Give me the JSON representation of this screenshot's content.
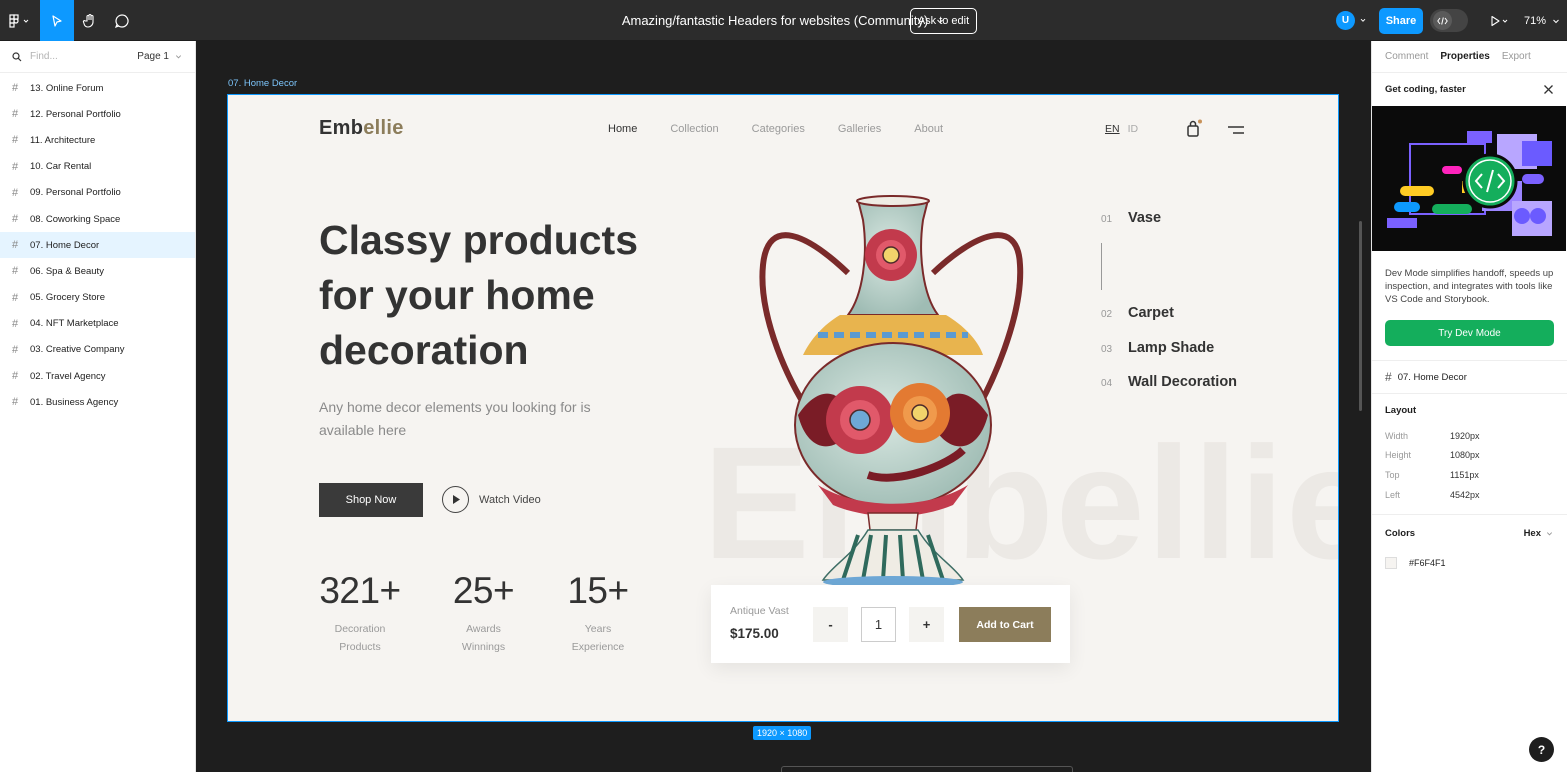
{
  "toolbar": {
    "doc_title": "Amazing/fantastic Headers for websites (Community)",
    "ask_to_edit": "Ask to edit",
    "avatar_initial": "U",
    "share": "Share",
    "zoom": "71%"
  },
  "layers_panel": {
    "search_placeholder": "Find...",
    "page": "Page 1",
    "items": [
      "13. Online Forum",
      "12. Personal Portfolio",
      "11. Architecture",
      "10. Car Rental",
      "09. Personal Portfolio",
      "08. Coworking Space",
      "07. Home Decor",
      "06. Spa & Beauty",
      "05. Grocery Store",
      "04. NFT Marketplace",
      "03. Creative Company",
      "02. Travel Agency",
      "01. Business Agency"
    ],
    "selected_index": 6
  },
  "canvas": {
    "frame_label": "07. Home Decor",
    "size_badge": "1920 × 1080",
    "bg_color": "#f6f4f1",
    "accent_color": "#8c7d5b"
  },
  "site": {
    "logo_main": "Emb",
    "logo_accent": "ellie",
    "nav": [
      "Home",
      "Collection",
      "Categories",
      "Galleries",
      "About"
    ],
    "lang_en": "EN",
    "lang_id": "ID",
    "hero_title": "Classy products for your home decoration",
    "hero_subtitle": "Any home decor elements you looking for is available here",
    "shop_now": "Shop Now",
    "watch_video": "Watch Video",
    "stats": [
      {
        "value": "321+",
        "label": "Decoration Products"
      },
      {
        "value": "25+",
        "label": "Awards Winnings"
      },
      {
        "value": "15+",
        "label": "Years Experience"
      }
    ],
    "watermark": "Embellie",
    "categories": [
      {
        "num": "01",
        "name": "Vase"
      },
      {
        "num": "02",
        "name": "Carpet"
      },
      {
        "num": "03",
        "name": "Lamp Shade"
      },
      {
        "num": "04",
        "name": "Wall Decoration"
      }
    ],
    "product": {
      "name": "Antique Vast",
      "price": "$175.00",
      "minus": "-",
      "qty": "1",
      "plus": "+",
      "add_to_cart": "Add to Cart"
    }
  },
  "properties_panel": {
    "tabs": [
      "Comment",
      "Properties",
      "Export"
    ],
    "active_tab": "Properties",
    "promo_title": "Get coding, faster",
    "promo_text": "Dev Mode simplifies handoff, speeds up inspection, and integrates with tools like VS Code and Storybook.",
    "try_button": "Try Dev Mode",
    "frame_name": "07. Home Decor",
    "layout_title": "Layout",
    "layout": [
      {
        "key": "Width",
        "value": "1920px"
      },
      {
        "key": "Height",
        "value": "1080px"
      },
      {
        "key": "Top",
        "value": "1151px"
      },
      {
        "key": "Left",
        "value": "4542px"
      }
    ],
    "colors_title": "Colors",
    "color_format": "Hex",
    "color_value": "#F6F4F1",
    "help": "?"
  }
}
